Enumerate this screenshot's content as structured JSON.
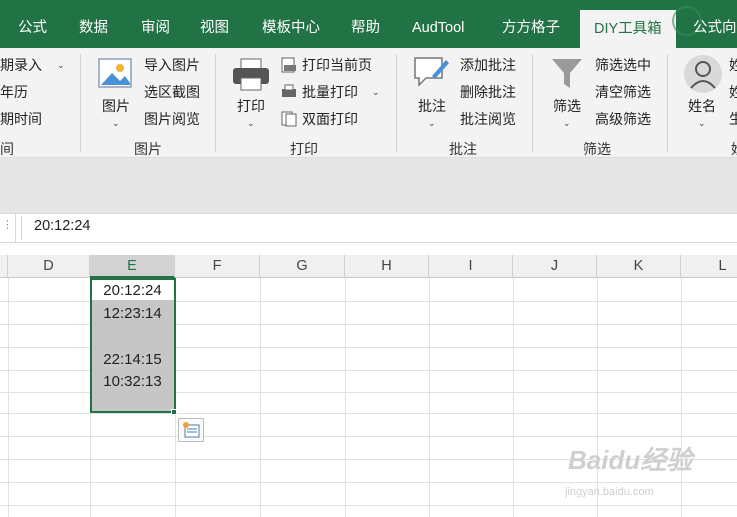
{
  "tabs": [
    "公式",
    "数据",
    "审阅",
    "视图",
    "模板中心",
    "帮助",
    "AudTool",
    "方方格子",
    "DIY工具箱",
    "公式向"
  ],
  "ribbon": {
    "date_group": {
      "items": [
        "期录入",
        "年历",
        "期时间"
      ],
      "label": "间"
    },
    "picture_group": {
      "big_button": "图片",
      "items": [
        "导入图片",
        "选区截图",
        "图片阅览"
      ],
      "label": "图片"
    },
    "print_group": {
      "big_button": "打印",
      "items": [
        "打印当前页",
        "批量打印",
        "双面打印"
      ],
      "label": "打印"
    },
    "comment_group": {
      "big_button": "批注",
      "items": [
        "添加批注",
        "删除批注",
        "批注阅览"
      ],
      "label": "批注"
    },
    "filter_group": {
      "big_button": "筛选",
      "items": [
        "筛选选中",
        "清空筛选",
        "高级筛选"
      ],
      "label": "筛选"
    },
    "name_group": {
      "big_button": "姓名",
      "items": [
        "姓",
        "姓",
        "生"
      ],
      "label": "姓"
    }
  },
  "formula_bar": {
    "value": "20:12:24"
  },
  "columns": [
    "D",
    "E",
    "F",
    "G",
    "H",
    "I",
    "J",
    "K",
    "L"
  ],
  "selected_column": "E",
  "cells": {
    "E1": "20:12:24",
    "E2": "12:23:14",
    "E3": "",
    "E4": "22:14:15",
    "E5": "10:32:13",
    "E6": ""
  },
  "watermark": {
    "brand": "Baidu经验",
    "url": "jingyan.baidu.com"
  },
  "colors": {
    "accent": "#217346",
    "selection_fill": "#c6c6c6"
  }
}
